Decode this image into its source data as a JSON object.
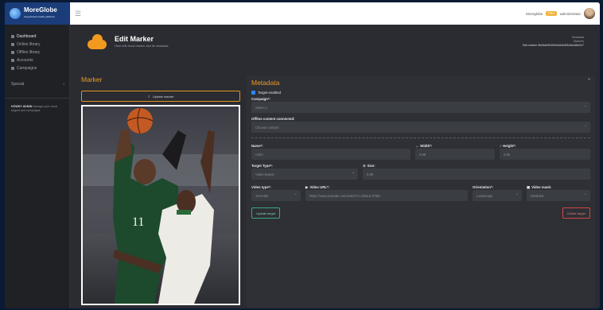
{
  "brand": {
    "name": "MoreGlobe",
    "tagline": "Augmented reality platform"
  },
  "sidebar": {
    "items": [
      {
        "label": "Dashboard",
        "icon": "home-icon"
      },
      {
        "label": "Online library",
        "icon": "cloud-icon"
      },
      {
        "label": "Offline library",
        "icon": "folder-icon"
      },
      {
        "label": "Accounts",
        "icon": "user-icon"
      },
      {
        "label": "Campaigns",
        "icon": "flag-icon"
      }
    ],
    "special": "Special",
    "note_bold": "HOWDY ADMIN",
    "note": "Manage your cloud targets and campaigns"
  },
  "topbar": {
    "username": "Moreglobe",
    "badge": "PRO",
    "account": "administrator"
  },
  "header": {
    "title": "Edit Marker",
    "subtitle": "Here edit cloud marker and its metadata",
    "crumb1": "Metadata",
    "crumb2": "Markers",
    "crumb3": "Edit marker 5be5ab9f42b0e8a3d4f9c6a1d8e2e7"
  },
  "marker": {
    "title": "Marker",
    "upload_label": "Update marker"
  },
  "metadata": {
    "title": "Metadata",
    "target_enabled": "Target enabled",
    "campaign_label": "Campaign*:",
    "campaign_value": "Select 1",
    "offline_label": "Offline content connected:",
    "offline_value": "Choose content",
    "name_label": "Name*:",
    "name_value": "Celts",
    "width_label": "Width*:",
    "width_value": "0.88",
    "height_label": "Height*:",
    "height_value": "0.86",
    "target_type_label": "Target Type*:",
    "target_type_value": "Video-based",
    "size_label": "Size:",
    "size_value": "0.88",
    "video_type_label": "Video type*:",
    "video_type_value": "YouTube",
    "video_url_label": "Video URL*:",
    "video_url_value": "https://www.youtube.com/watch?v=2k3L9-ZTBU",
    "orientation_label": "Orientation*:",
    "orientation_value": "Landscape",
    "video_mask_label": "Video mask:",
    "video_mask_value": "Disabled",
    "update_button": "Update target",
    "delete_button": "Delete target"
  },
  "colors": {
    "accent": "#f29a1f",
    "brand_bar": "#1a3d7a",
    "success": "#3aa884",
    "danger": "#d64545"
  }
}
